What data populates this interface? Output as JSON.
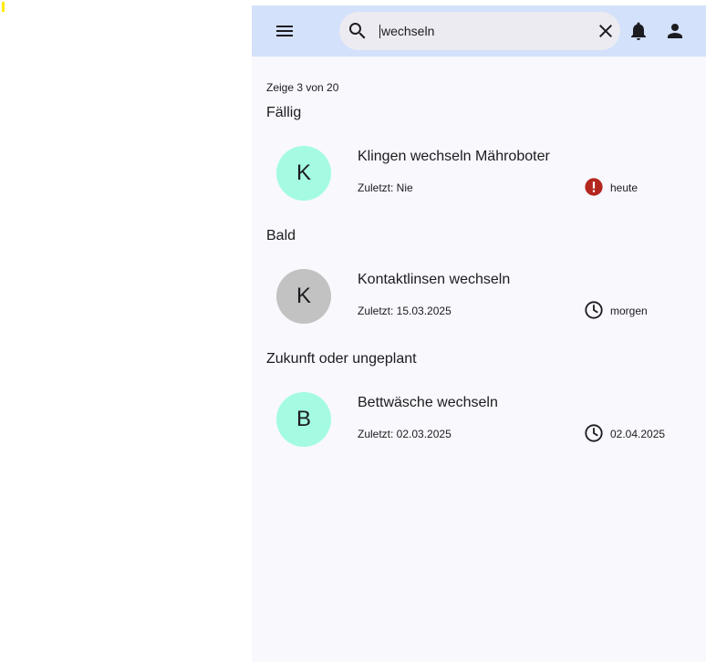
{
  "search": {
    "value": "wechseln",
    "placeholder": ""
  },
  "count_text": "Zeige 3 von 20",
  "colors": {
    "appbar": "#d3e1fb",
    "background": "#f8f8fd",
    "search_bg": "#ecebf1",
    "avatar_teal": "#a4fbe2",
    "avatar_gray": "#c2c2c2",
    "overdue_red": "#b3261e"
  },
  "icons": {
    "menu": "menu-icon",
    "search": "search-icon",
    "clear": "close-icon",
    "notifications": "bell-icon",
    "account": "person-icon"
  },
  "sections": [
    {
      "title": "Fällig",
      "items": [
        {
          "avatar": "K",
          "avatar_color": "#a4fbe2",
          "title": "Klingen wechseln Mähroboter",
          "last": "Zuletzt: Nie",
          "due_icon": "alert-icon",
          "due": "heute"
        }
      ]
    },
    {
      "title": "Bald",
      "items": [
        {
          "avatar": "K",
          "avatar_color": "#c2c2c2",
          "title": "Kontaktlinsen wechseln",
          "last": "Zuletzt: 15.03.2025",
          "due_icon": "clock-icon",
          "due": "morgen"
        }
      ]
    },
    {
      "title": "Zukunft oder ungeplant",
      "items": [
        {
          "avatar": "B",
          "avatar_color": "#a4fbe2",
          "title": "Bettwäsche wechseln",
          "last": "Zuletzt: 02.03.2025",
          "due_icon": "clock-icon",
          "due": "02.04.2025"
        }
      ]
    }
  ]
}
